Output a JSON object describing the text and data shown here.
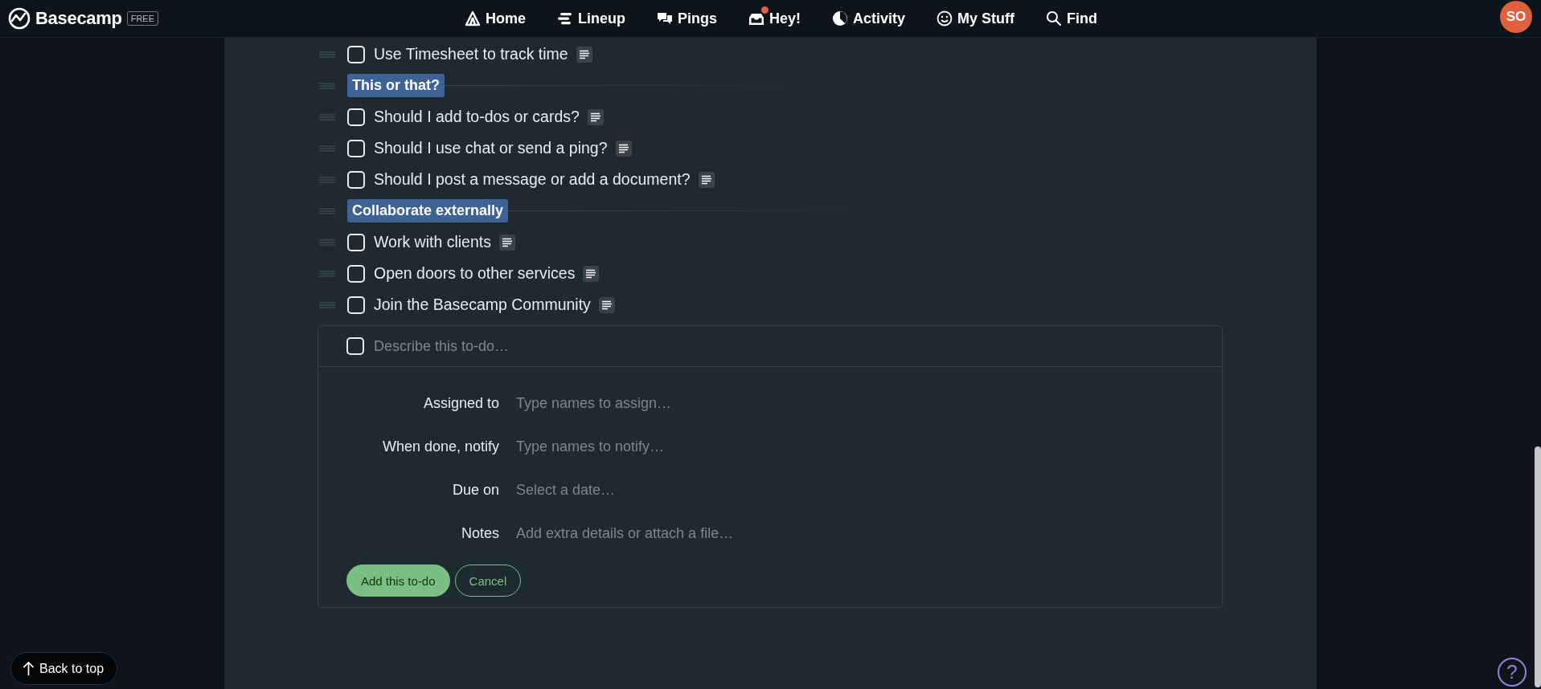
{
  "header": {
    "logo": {
      "name": "Basecamp",
      "badge": "FREE"
    },
    "nav": [
      {
        "label": "Home",
        "notification": false
      },
      {
        "label": "Lineup",
        "notification": false
      },
      {
        "label": "Pings",
        "notification": false
      },
      {
        "label": "Hey!",
        "notification": true
      },
      {
        "label": "Activity",
        "notification": false
      },
      {
        "label": "My Stuff",
        "notification": false
      },
      {
        "label": "Find",
        "notification": false
      }
    ],
    "avatar": {
      "initials": "SO"
    }
  },
  "list": [
    {
      "kind": "todo",
      "text": "Use Timesheet to track time",
      "checked": false,
      "notes": true
    },
    {
      "kind": "group",
      "text": "This or that?"
    },
    {
      "kind": "todo",
      "text": "Should I add to-dos or cards?",
      "checked": false,
      "notes": true
    },
    {
      "kind": "todo",
      "text": "Should I use chat or send a ping?",
      "checked": false,
      "notes": true
    },
    {
      "kind": "todo",
      "text": "Should I post a message or add a document?",
      "checked": false,
      "notes": true
    },
    {
      "kind": "group",
      "text": "Collaborate externally"
    },
    {
      "kind": "todo",
      "text": "Work with clients",
      "checked": false,
      "notes": true
    },
    {
      "kind": "todo",
      "text": "Open doors to other services",
      "checked": false,
      "notes": true
    },
    {
      "kind": "todo",
      "text": "Join the Basecamp Community",
      "checked": false,
      "notes": true
    }
  ],
  "new_todo": {
    "checked": false,
    "placeholder": "Describe this to-do…",
    "fields": [
      {
        "label": "Assigned to",
        "placeholder": "Type names to assign…"
      },
      {
        "label": "When done, notify",
        "placeholder": "Type names to notify…"
      },
      {
        "label": "Due on",
        "placeholder": "Select a date…"
      },
      {
        "label": "Notes",
        "placeholder": "Add extra details or attach a file…"
      }
    ],
    "buttons": [
      {
        "label": "Add this to-do",
        "kind": "primary"
      },
      {
        "label": "Cancel",
        "kind": "secondary"
      }
    ]
  },
  "back_to_top": {
    "label": "Back to top"
  },
  "help": {
    "glyph": "?"
  }
}
